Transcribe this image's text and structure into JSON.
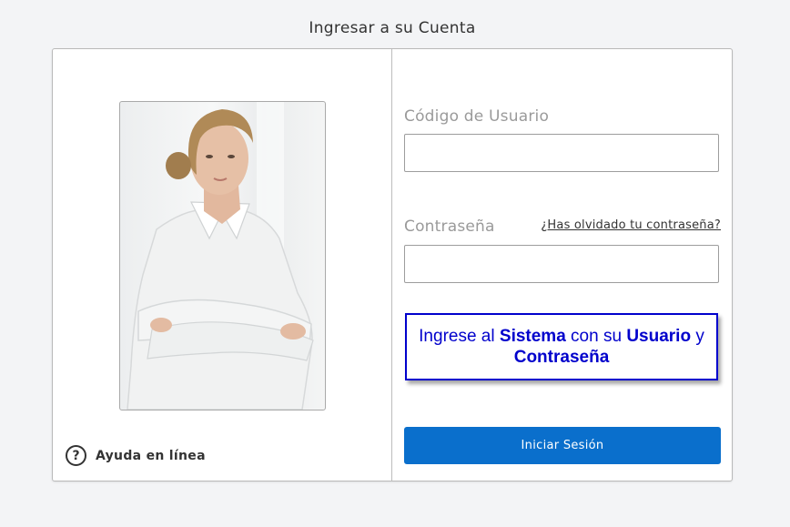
{
  "page": {
    "title": "Ingresar a su Cuenta"
  },
  "left_panel": {
    "help_icon_glyph": "?",
    "help_label": "Ayuda en línea",
    "photo_icon": "woman-portrait-photo"
  },
  "form": {
    "user_label": "Código de Usuario",
    "user_value": "",
    "password_label": "Contraseña",
    "password_value": "",
    "forgot_link": "¿Has olvidado tu contraseña?",
    "notice": {
      "t1": "Ingrese al ",
      "b1": "Sistema",
      "t2": " con su ",
      "b2": "Usuario",
      "t3": " y ",
      "b3": "Contraseña",
      "color": "#0000cc"
    },
    "submit_label": "Iniciar Sesión"
  },
  "colors": {
    "primary_button": "#0a6fcc",
    "background": "#f3f4f6"
  }
}
